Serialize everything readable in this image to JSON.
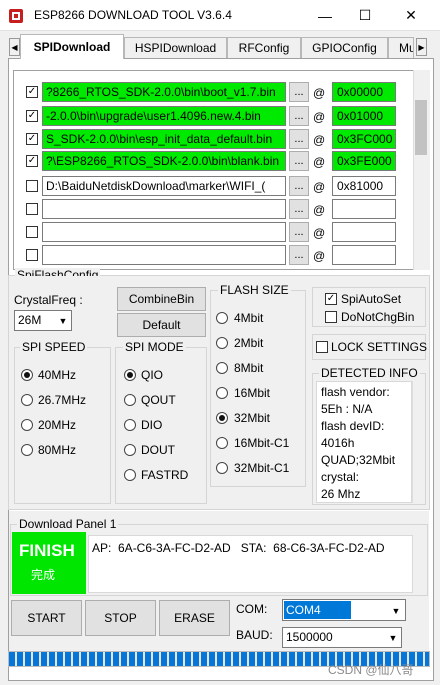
{
  "window": {
    "title": "ESP8266 DOWNLOAD TOOL V3.6.4",
    "minimize_glyph": "—",
    "maximize_glyph": "☐",
    "close_glyph": "✕"
  },
  "tabs": [
    {
      "label": "SPIDownload",
      "active": true
    },
    {
      "label": "HSPIDownload",
      "active": false
    },
    {
      "label": "RFConfig",
      "active": false
    },
    {
      "label": "GPIOConfig",
      "active": false
    },
    {
      "label": "Mu",
      "active": false
    }
  ],
  "files": [
    {
      "checked": true,
      "path": "?8266_RTOS_SDK-2.0.0\\bin\\boot_v1.7.bin",
      "address": "0x00000",
      "highlight": true
    },
    {
      "checked": true,
      "path": "-2.0.0\\bin\\upgrade\\user1.4096.new.4.bin",
      "address": "0x01000",
      "highlight": true
    },
    {
      "checked": true,
      "path": "S_SDK-2.0.0\\bin\\esp_init_data_default.bin",
      "address": "0x3FC000",
      "highlight": true
    },
    {
      "checked": true,
      "path": "?\\ESP8266_RTOS_SDK-2.0.0\\bin\\blank.bin",
      "address": "0x3FE000",
      "highlight": true
    },
    {
      "checked": false,
      "path": "D:\\BaiduNetdiskDownload\\marker\\WIFI_(",
      "address": "0x81000",
      "highlight": false
    },
    {
      "checked": false,
      "path": "",
      "address": "",
      "highlight": false
    },
    {
      "checked": false,
      "path": "",
      "address": "",
      "highlight": false
    },
    {
      "checked": false,
      "path": "",
      "address": "",
      "highlight": false
    }
  ],
  "browse_label": "...",
  "at_label": "@",
  "check_glyph": "✓",
  "spi_flash_config": {
    "title": "SpiFlashConfig",
    "crystal_label": "CrystalFreq :",
    "crystal_value": "26M",
    "combine_button": "CombineBin",
    "default_button": "Default"
  },
  "spi_speed": {
    "title": "SPI SPEED",
    "options": [
      {
        "label": "40MHz",
        "selected": true
      },
      {
        "label": "26.7MHz",
        "selected": false
      },
      {
        "label": "20MHz",
        "selected": false
      },
      {
        "label": "80MHz",
        "selected": false
      }
    ]
  },
  "spi_mode": {
    "title": "SPI MODE",
    "options": [
      {
        "label": "QIO",
        "selected": true
      },
      {
        "label": "QOUT",
        "selected": false
      },
      {
        "label": "DIO",
        "selected": false
      },
      {
        "label": "DOUT",
        "selected": false
      },
      {
        "label": "FASTRD",
        "selected": false
      }
    ]
  },
  "flash_size": {
    "title": "FLASH SIZE",
    "options": [
      {
        "label": "4Mbit",
        "selected": false
      },
      {
        "label": "2Mbit",
        "selected": false
      },
      {
        "label": "8Mbit",
        "selected": false
      },
      {
        "label": "16Mbit",
        "selected": false
      },
      {
        "label": "32Mbit",
        "selected": true
      },
      {
        "label": "16Mbit-C1",
        "selected": false
      },
      {
        "label": "32Mbit-C1",
        "selected": false
      }
    ]
  },
  "options": {
    "spi_auto_set": {
      "label": "SpiAutoSet",
      "checked": true
    },
    "do_not_chg_bin": {
      "label": "DoNotChgBin",
      "checked": false
    },
    "lock_settings": {
      "label": "LOCK SETTINGS",
      "checked": false
    }
  },
  "detected_info": {
    "title": "DETECTED INFO",
    "lines": [
      "flash vendor:",
      "5Eh : N/A",
      "flash devID:",
      "4016h",
      "QUAD;32Mbit",
      "crystal:",
      "26 Mhz"
    ]
  },
  "download_panel": {
    "title": "Download Panel 1",
    "status": "FINISH",
    "status_sub": "完成",
    "status_color": "#00e600",
    "ap_text": "AP:  6A-C6-3A-FC-D2-AD   STA:  68-C6-3A-FC-D2-AD"
  },
  "actions": {
    "start": "START",
    "stop": "STOP",
    "erase": "ERASE"
  },
  "com": {
    "label": "COM:",
    "value": "COM4"
  },
  "baud": {
    "label": "BAUD:",
    "value": "1500000"
  },
  "progress": {
    "fraction": 1.0
  },
  "watermark": "CSDN @仙八哥",
  "colors": {
    "highlight_green": "#00ea00",
    "selection_blue": "#0078d7",
    "progress_blue": "#0677d9"
  }
}
